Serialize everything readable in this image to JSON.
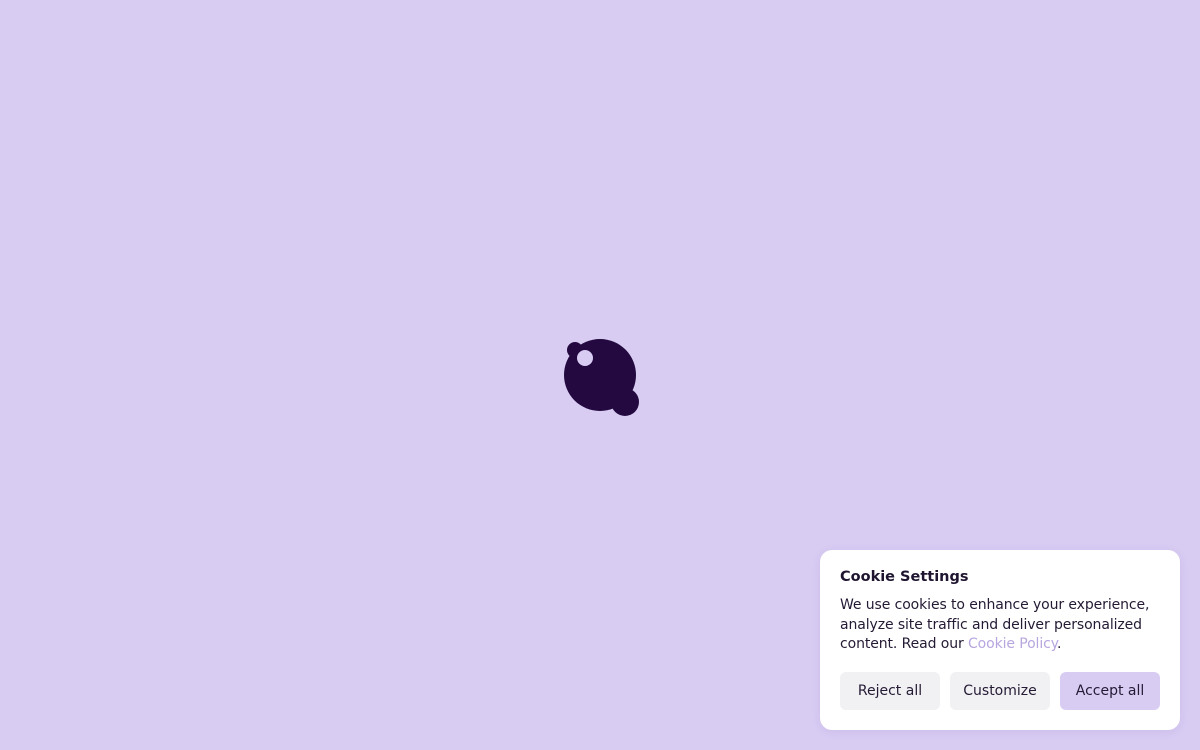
{
  "colors": {
    "page_background": "#d8ccf3",
    "logo": "#23093f",
    "panel_background": "#ffffff",
    "link": "#b7a6df",
    "primary_button": "#d8ccf3",
    "secondary_button": "#f1f0f3"
  },
  "loader": {
    "icon": "brand-logo-icon"
  },
  "cookie_banner": {
    "title": "Cookie Settings",
    "text_before_link": "We use cookies to enhance your experience, analyze site traffic and deliver personalized content. Read our ",
    "link_label": "Cookie Policy",
    "text_after_link": ".",
    "buttons": {
      "reject": "Reject all",
      "customize": "Customize",
      "accept": "Accept all"
    }
  }
}
